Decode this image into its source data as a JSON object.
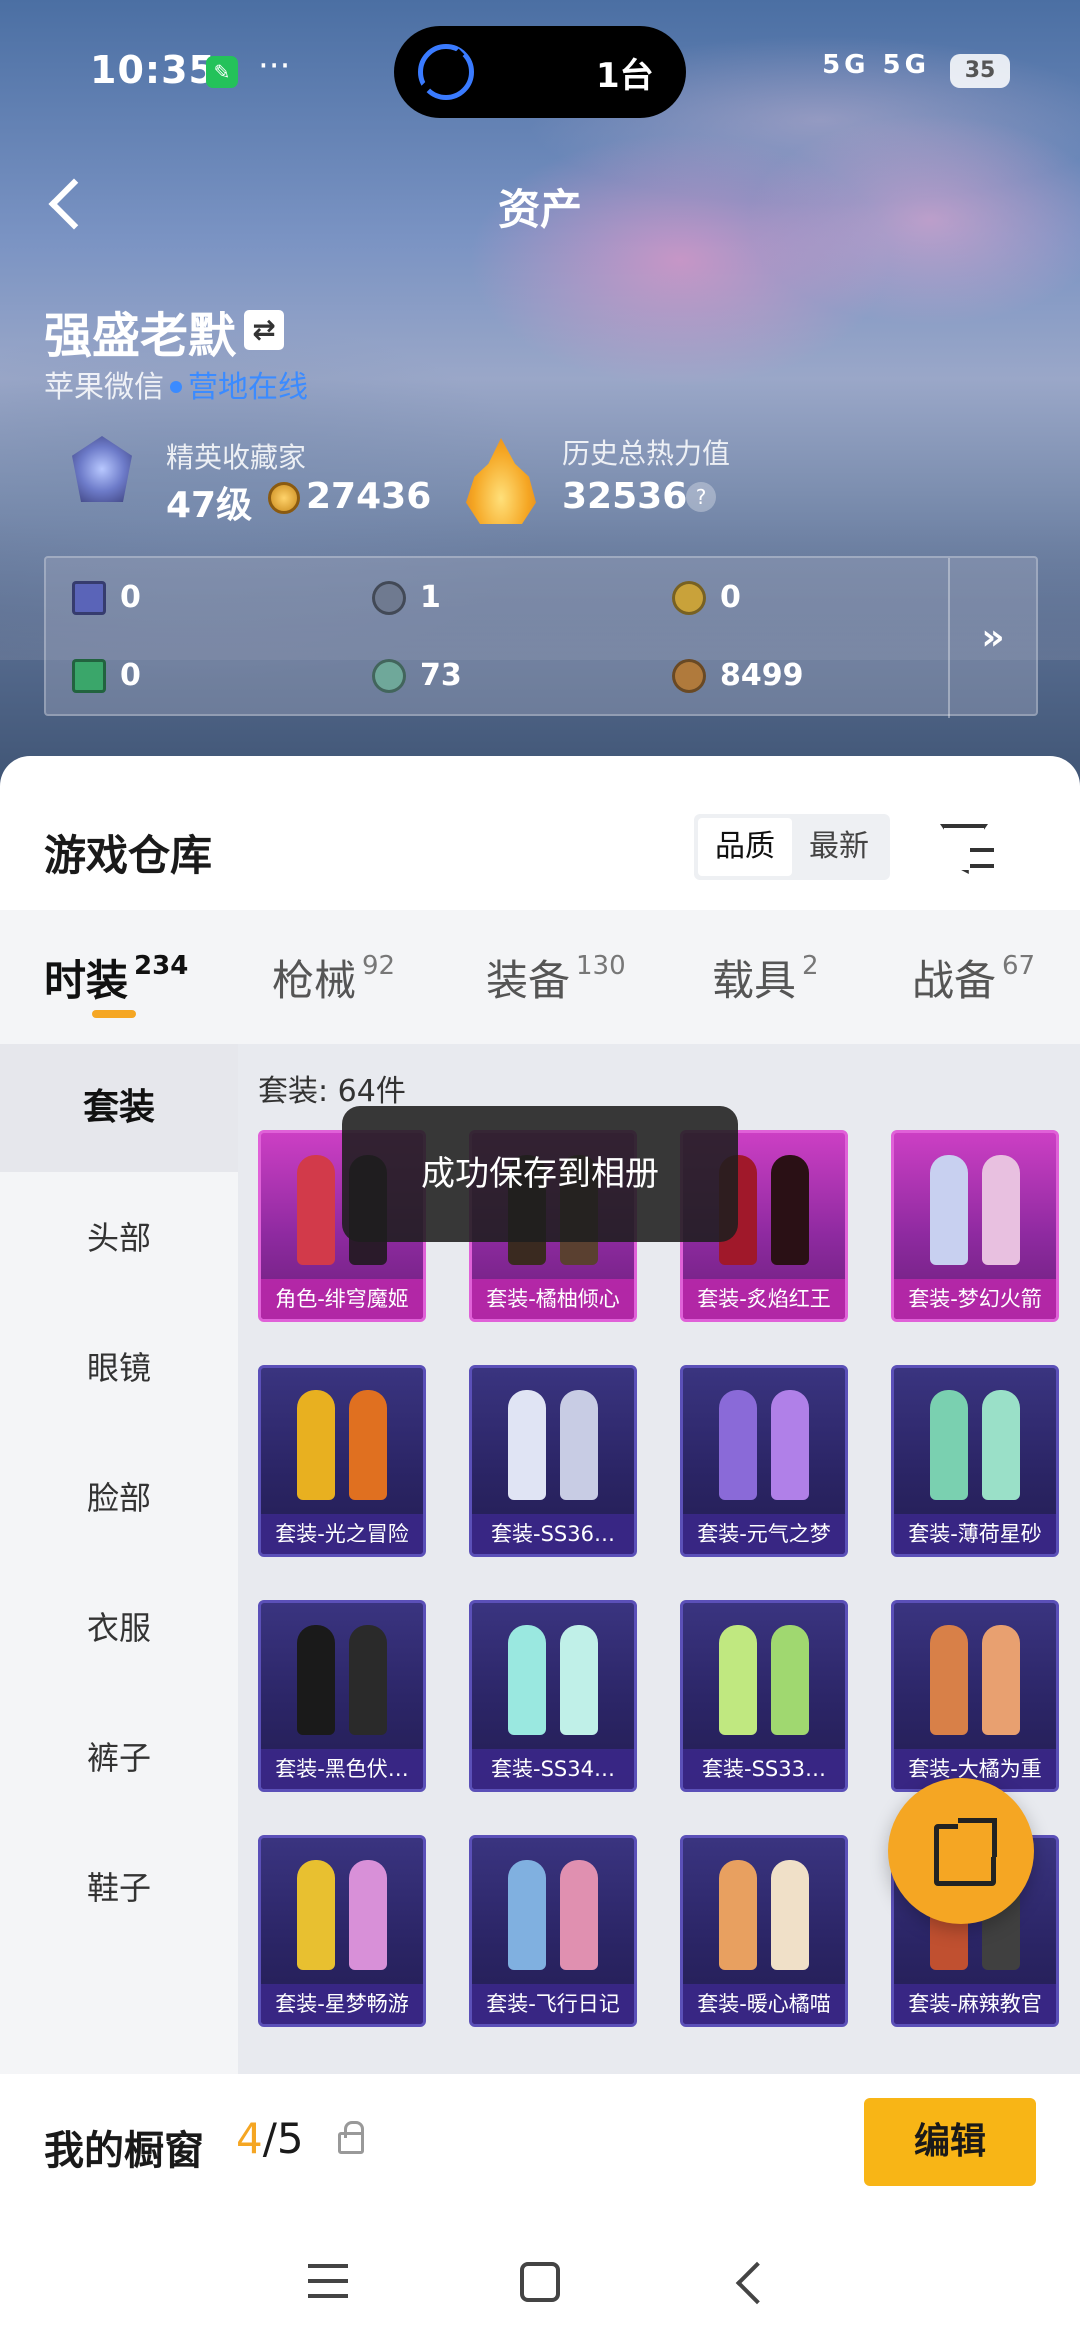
{
  "status_bar": {
    "time": "10:35",
    "more": "···",
    "island_text": "1台",
    "signal": "5G 5G",
    "battery": "35"
  },
  "header": {
    "title": "资产"
  },
  "profile": {
    "name": "强盛老默",
    "account_type": "苹果微信",
    "online_status": "营地在线",
    "rank_label": "精英收藏家",
    "level": "47级",
    "coins": "27436",
    "heat_label": "历史总热力值",
    "heat_value": "32536",
    "help": "?"
  },
  "resources": [
    {
      "value": "0",
      "color": "#5a64b8"
    },
    {
      "value": "1",
      "color": "#6f7a90"
    },
    {
      "value": "0",
      "color": "#c9a23a"
    },
    {
      "value": "0",
      "color": "#3aa66a"
    },
    {
      "value": "73",
      "color": "#6fa89a"
    },
    {
      "value": "8499",
      "color": "#b07a3c"
    }
  ],
  "resources_more": "»",
  "warehouse": {
    "title": "游戏仓库",
    "sort_options": [
      "品质",
      "最新"
    ],
    "sort_selected": "品质"
  },
  "tabs": [
    {
      "label": "时装",
      "count": "234"
    },
    {
      "label": "枪械",
      "count": "92"
    },
    {
      "label": "装备",
      "count": "130"
    },
    {
      "label": "载具",
      "count": "2"
    },
    {
      "label": "战备",
      "count": "67"
    }
  ],
  "categories": [
    "套装",
    "头部",
    "眼镜",
    "脸部",
    "衣服",
    "裤子",
    "鞋子"
  ],
  "grid": {
    "count_label": "套装: 64件",
    "items": [
      {
        "label": "角色-绯穹魔姬",
        "c1": "#d23a4a",
        "c2": "#2a1a2a"
      },
      {
        "label": "套装-橘柚倾心",
        "c1": "#3a2a20",
        "c2": "#5a4030"
      },
      {
        "label": "套装-炙焰红王",
        "c1": "#a0182a",
        "c2": "#2a1015"
      },
      {
        "label": "套装-梦幻火箭",
        "c1": "#c8d0f0",
        "c2": "#e8c0e0"
      },
      {
        "label": "套装-光之冒险",
        "c1": "#e8b020",
        "c2": "#e07020"
      },
      {
        "label": "套装-SS36…",
        "c1": "#e0e4f4",
        "c2": "#c8cce4"
      },
      {
        "label": "套装-元气之梦",
        "c1": "#8a6ad8",
        "c2": "#b080e8"
      },
      {
        "label": "套装-薄荷星砂",
        "c1": "#7ad0b0",
        "c2": "#9ae0c8"
      },
      {
        "label": "套装-黑色伏…",
        "c1": "#1a1a1a",
        "c2": "#2a2a2a"
      },
      {
        "label": "套装-SS34…",
        "c1": "#9ae8e0",
        "c2": "#c0f0e8"
      },
      {
        "label": "套装-SS33…",
        "c1": "#c0e880",
        "c2": "#a0d870"
      },
      {
        "label": "套装-大橘为重",
        "c1": "#d88048",
        "c2": "#e8a070"
      },
      {
        "label": "套装-星梦畅游",
        "c1": "#e8c030",
        "c2": "#d890d8"
      },
      {
        "label": "套装-飞行日记",
        "c1": "#80b0e0",
        "c2": "#e090b0"
      },
      {
        "label": "套装-暖心橘喵",
        "c1": "#e8a060",
        "c2": "#f0e0c8"
      },
      {
        "label": "套装-麻辣教官",
        "c1": "#c05030",
        "c2": "#404040"
      }
    ]
  },
  "toast": "成功保存到相册",
  "showcase": {
    "label": "我的橱窗",
    "current": "4",
    "total": "/5",
    "edit_label": "编辑"
  }
}
